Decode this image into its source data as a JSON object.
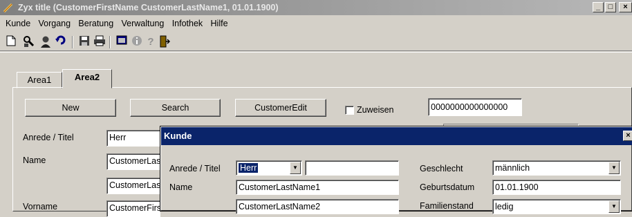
{
  "window": {
    "title": "Zyx title  (CustomerFirstName  CustomerLastName1, 01.01.1900)",
    "controls": [
      "_",
      "□",
      "×"
    ]
  },
  "menu": [
    "Kunde",
    "Vorgang",
    "Beratung",
    "Verwaltung",
    "Infothek",
    "Hilfe"
  ],
  "toolbar": {
    "icons": [
      "new-document-icon",
      "search-person-icon",
      "person-icon",
      "undo-icon",
      "save-icon",
      "print-icon",
      "window-icon",
      "info-icon",
      "help-icon",
      "exit-door-icon"
    ],
    "glyphs": {
      "help": "?"
    }
  },
  "tabs": [
    "Area1",
    "Area2"
  ],
  "buttons": {
    "new": "New",
    "search": "Search",
    "customer_edit": "CustomerEdit"
  },
  "zuweisen_label": "Zuweisen",
  "id_field": "0000000000000000",
  "form": {
    "anrede_label": "Anrede / Titel",
    "anrede_value": "Herr",
    "name_label": "Name",
    "name_value1": "CustomerLastName1",
    "name_value2": "CustomerLastName2",
    "vorname_label": "Vorname",
    "vorname_value": "CustomerFirstName"
  },
  "dialog": {
    "title": "Kunde",
    "close": "×",
    "anrede_label": "Anrede / Titel",
    "anrede_value": "Herr",
    "titel_value": "",
    "name_label": "Name",
    "name_value1": "CustomerLastName1",
    "name_value2": "CustomerLastName2",
    "geschlecht_label": "Geschlecht",
    "geschlecht_value": "männlich",
    "geburtsdatum_label": "Geburtsdatum",
    "geburtsdatum_value": "01.01.1900",
    "familienstand_label": "Familienstand",
    "familienstand_value": "ledig"
  },
  "colors": {
    "dialog_title_bg": "#0a246a",
    "titlebar_inactive": "#808080",
    "face": "#d4d0c8"
  }
}
